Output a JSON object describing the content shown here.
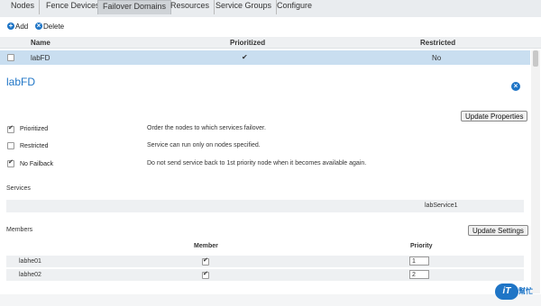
{
  "tabs": [
    {
      "label": "Nodes"
    },
    {
      "label": "Fence Devices"
    },
    {
      "label": "Failover Domains"
    },
    {
      "label": "Resources"
    },
    {
      "label": "Service Groups"
    },
    {
      "label": "Configure"
    }
  ],
  "toolbar": {
    "add_label": "Add",
    "delete_label": "Delete"
  },
  "domains_table": {
    "headers": {
      "name": "Name",
      "prioritized": "Prioritized",
      "restricted": "Restricted"
    },
    "rows": [
      {
        "name": "labFD",
        "prioritized": "✔",
        "restricted": "No"
      }
    ]
  },
  "detail": {
    "title": "labFD",
    "update_properties_label": "Update Properties",
    "options": [
      {
        "label": "Prioritized",
        "checked": true,
        "desc": "Order the nodes to which services failover."
      },
      {
        "label": "Restricted",
        "checked": false,
        "desc": "Service can run only on nodes specified."
      },
      {
        "label": "No Failback",
        "checked": true,
        "desc": "Do not send service back to 1st priority node when it becomes available again."
      }
    ],
    "services_title": "Services",
    "service_name": "labService1",
    "members_title": "Members",
    "update_settings_label": "Update Settings",
    "members_headers": {
      "member": "Member",
      "priority": "Priority"
    },
    "members": [
      {
        "name": "labhe01",
        "member": true,
        "priority": "1"
      },
      {
        "name": "labhe02",
        "member": true,
        "priority": "2"
      }
    ]
  },
  "logo": {
    "mark": "iT",
    "text": "幫忙"
  },
  "colors": {
    "accent": "#1f75c6",
    "selected_row": "#c9def0"
  }
}
